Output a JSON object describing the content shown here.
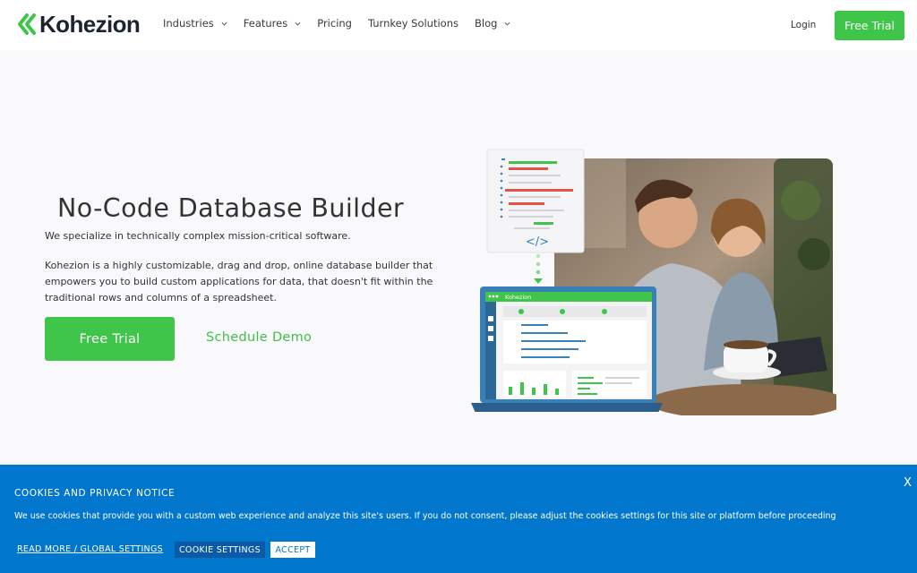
{
  "header": {
    "logo_text": "Kohezion",
    "nav": [
      {
        "label": "Industries"
      },
      {
        "label": "Features"
      },
      {
        "label": "Pricing"
      },
      {
        "label": "Turnkey Solutions"
      },
      {
        "label": "Blog"
      }
    ],
    "login_label": "Login",
    "free_trial_label": "Free Trial"
  },
  "hero": {
    "title": "No-Code Database Builder",
    "subtitle": "We specialize in technically complex mission-critical software.",
    "description": "Kohezion is a highly customizable, drag and drop, online database builder that empowers you to build custom applications for data, that doesn't fit within the traditional rows and columns of a spreadsheet.",
    "primary_button": "Free Trial",
    "secondary_link": "Schedule Demo",
    "illustration": {
      "code_tag": "</>",
      "laptop_brand": "Kohezion"
    }
  },
  "cookie": {
    "title": "COOKIES AND PRIVACY NOTICE",
    "text": "We use cookies that provide you with a custom web experience and analyze this site's users. If you do not consent, please adjust the cookies settings for this site or platform before proceeding",
    "close_label": "X",
    "read_more_label": "READ MORE / GLOBAL SETTINGS",
    "settings_label": "COOKIE SETTINGS",
    "accept_label": "ACCEPT"
  },
  "colors": {
    "brand_green": "#3fc64a",
    "banner_blue": "#0077cc",
    "laptop_blue": "#3a80b8"
  },
  "icons": [
    "kohezion-logo-icon",
    "chevron-down-icon",
    "code-icon"
  ]
}
